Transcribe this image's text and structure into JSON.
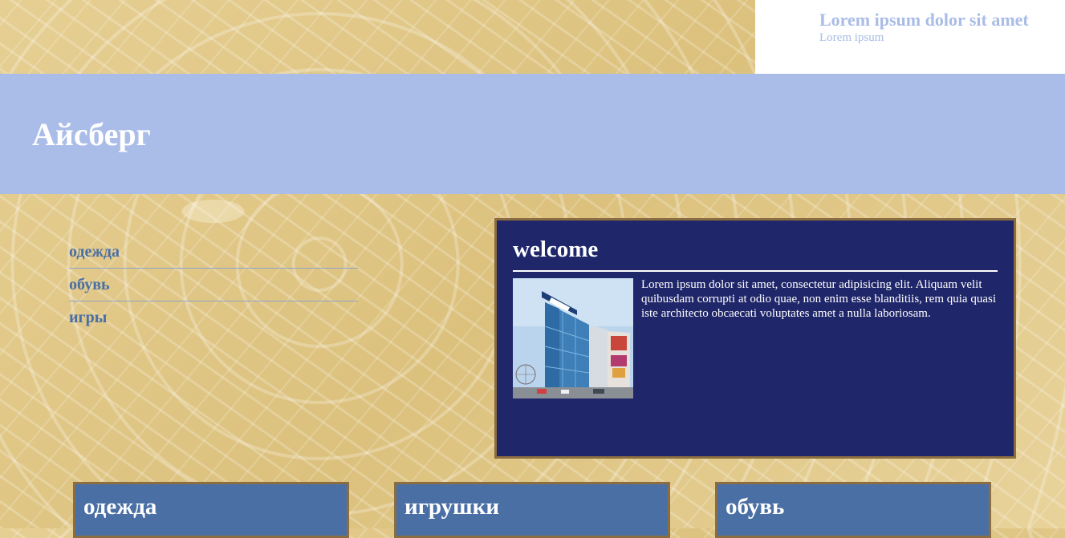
{
  "header": {
    "site_title": "Lorem ipsum dolor sit amet",
    "site_subtitle": "Lorem ipsum"
  },
  "banner": {
    "brand": "Айсберг"
  },
  "sidebar": {
    "items": [
      {
        "label": "одежда"
      },
      {
        "label": "обувь"
      },
      {
        "label": "игры"
      }
    ]
  },
  "welcome": {
    "title": "welcome",
    "text": "Lorem ipsum dolor sit amet, consectetur adipisicing elit. Aliquam velit quibusdam corrupti at odio quae, non enim esse blanditiis, rem quia quasi iste architecto obcaecati voluptates amet a nulla laboriosam."
  },
  "cards": [
    {
      "title": "одежда"
    },
    {
      "title": "игрушки"
    },
    {
      "title": "обувь"
    }
  ],
  "colors": {
    "banner": "#aabde8",
    "welcome_bg": "#1f2669",
    "card_bg": "#4a6fa5",
    "border": "#8b6d3f",
    "nav_text": "#4a6fa5"
  }
}
